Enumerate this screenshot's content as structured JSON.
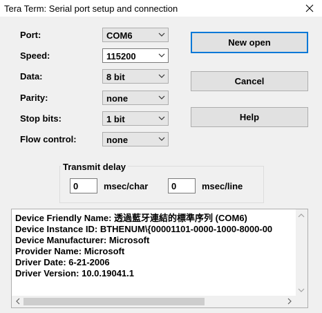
{
  "window": {
    "title": "Tera Term: Serial port setup and connection"
  },
  "fields": {
    "port": {
      "label": "Port:",
      "value": "COM6"
    },
    "speed": {
      "label": "Speed:",
      "value": "115200"
    },
    "data": {
      "label": "Data:",
      "value": "8 bit"
    },
    "parity": {
      "label": "Parity:",
      "value": "none"
    },
    "stop_bits": {
      "label": "Stop bits:",
      "value": "1 bit"
    },
    "flow_control": {
      "label": "Flow control:",
      "value": "none"
    }
  },
  "buttons": {
    "new_open": "New open",
    "cancel": "Cancel",
    "help": "Help"
  },
  "transmit_delay": {
    "title": "Transmit delay",
    "char_value": "0",
    "char_unit": "msec/char",
    "line_value": "0",
    "line_unit": "msec/line"
  },
  "device_info": {
    "lines": [
      "Device Friendly Name: 透過藍牙連結的標準序列 (COM6)",
      "Device Instance ID: BTHENUM\\{00001101-0000-1000-8000-00",
      "Device Manufacturer: Microsoft",
      "Provider Name: Microsoft",
      "Driver Date: 6-21-2006",
      "Driver Version: 10.0.19041.1"
    ]
  },
  "icons": {
    "close": "close-icon",
    "dropdown": "chevron-down-icon"
  }
}
